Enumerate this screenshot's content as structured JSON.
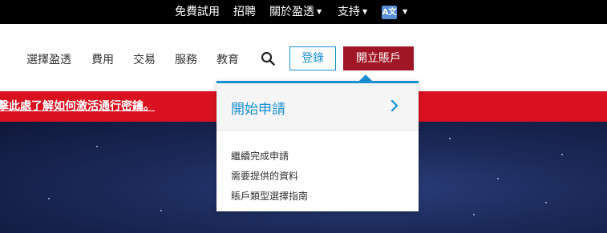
{
  "topbar": {
    "items": [
      "免費試用",
      "招聘",
      "關於盈透",
      "支持"
    ],
    "lang_icon_text": "A文"
  },
  "nav": {
    "items": [
      "選擇盈透",
      "費用",
      "交易",
      "服務",
      "教育"
    ],
    "login_label": "登錄",
    "open_account_label": "開立賬戶"
  },
  "banner": {
    "text": "擊此處了解如何激活通行密鑰。"
  },
  "dropdown": {
    "title": "開始申請",
    "links": [
      "繼續完成申請",
      "需要提供的資料",
      "賬戶類型選擇指南"
    ]
  },
  "colors": {
    "accent_blue": "#1a8fd1",
    "brand_red": "#a01624",
    "banner_red": "#d9101f"
  },
  "icons": [
    "search-icon",
    "chevron-down-icon",
    "chevron-right-icon",
    "translate-icon"
  ]
}
